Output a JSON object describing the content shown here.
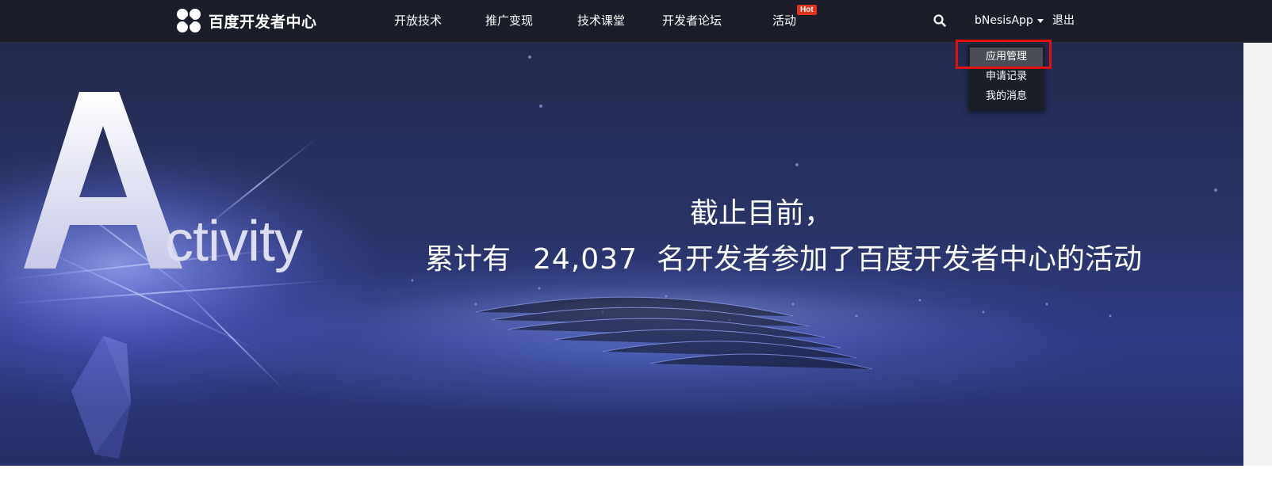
{
  "header": {
    "logo_text": "百度开发者中心",
    "nav": [
      {
        "label": "开放技术"
      },
      {
        "label": "推广变现"
      },
      {
        "label": "技术课堂"
      },
      {
        "label": "开发者论坛"
      },
      {
        "label": "活动"
      }
    ],
    "hot_badge": "Hot",
    "search_icon": "search-icon",
    "user_name": "bNesisApp",
    "logout_label": "退出"
  },
  "user_dropdown": {
    "items": [
      {
        "label": "应用管理",
        "active": true
      },
      {
        "label": "申请记录"
      },
      {
        "label": "我的消息"
      }
    ]
  },
  "hero": {
    "art_word": "ctivity",
    "line1": "截止目前，",
    "line2_prefix": "累计有",
    "count": "24,037",
    "line2_suffix": "名开发者参加了百度开发者中心的活动"
  },
  "colors": {
    "topbar_bg": "#1b1e28",
    "hot_badge": "#e0321f",
    "highlight": "#e01010",
    "hero_bg": "#2a3368"
  }
}
